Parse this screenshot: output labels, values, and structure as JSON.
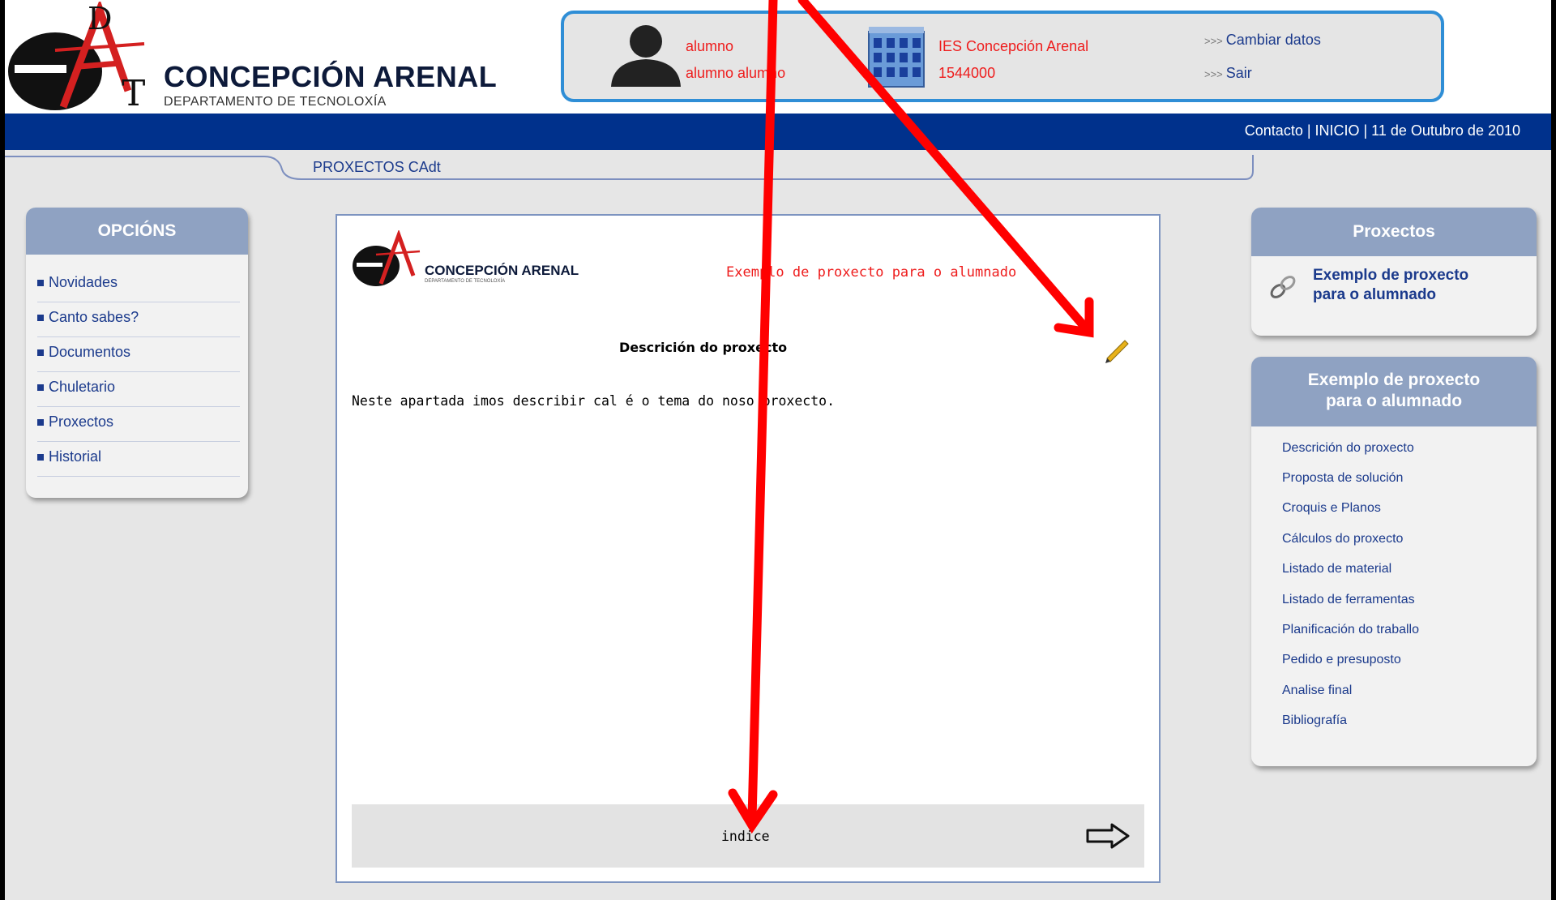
{
  "header": {
    "logo_letters": [
      "D",
      "A",
      "T"
    ],
    "site_title": "CONCEPCIÓN  ARENAL",
    "site_subtitle": "DEPARTAMENTO DE TECNOLOXÍA"
  },
  "user_panel": {
    "username": "alumno",
    "full_name": "alumno alumno",
    "school_name": "IES Concepción Arenal",
    "school_code": "1544000",
    "change_data_label": "Cambiar datos",
    "logout_label": "Sair"
  },
  "topnav": {
    "text": "Contacto | INICIO | 11 de Outubro de 2010"
  },
  "tab": {
    "label": "PROXECTOS CAdt"
  },
  "left_menu": {
    "title": "OPCIÓNS",
    "items": [
      {
        "label": "Novidades"
      },
      {
        "label": "Canto sabes?"
      },
      {
        "label": "Documentos"
      },
      {
        "label": "Chuletario"
      },
      {
        "label": "Proxectos"
      },
      {
        "label": "Historial"
      }
    ]
  },
  "main": {
    "logo_title": "CONCEPCIÓN  ARENAL",
    "logo_subtitle": "DEPARTAMENTO DE TECNOLOXÍA",
    "project_title": "Exemplo de proxecto para o alumnado",
    "section_title": "Descrición do proxecto",
    "body_text": "Neste apartada imos describir cal é o tema do noso proxecto.",
    "index_label": "indice"
  },
  "projects_box": {
    "title": "Proxectos",
    "link_line1": "Exemplo de proxecto",
    "link_line2": "para o alumnado"
  },
  "index_box": {
    "title_line1": "Exemplo de proxecto",
    "title_line2": "para o alumnado",
    "items": [
      {
        "label": "Descrición do proxecto"
      },
      {
        "label": "Proposta de solución"
      },
      {
        "label": "Croquis e Planos"
      },
      {
        "label": "Cálculos do proxecto"
      },
      {
        "label": "Listado de material"
      },
      {
        "label": "Listado de ferramentas"
      },
      {
        "label": "Planificación do traballo"
      },
      {
        "label": "Pedido e presuposto"
      },
      {
        "label": "Analise final"
      },
      {
        "label": "Bibliografía"
      }
    ]
  },
  "colors": {
    "annotation_arrow": "#ff0000",
    "nav_bar": "#00318c",
    "panel_border": "#2f8ed6",
    "box_header": "#8fa2c2",
    "link": "#1b3a8c",
    "highlight_text": "#ee1c1c"
  }
}
